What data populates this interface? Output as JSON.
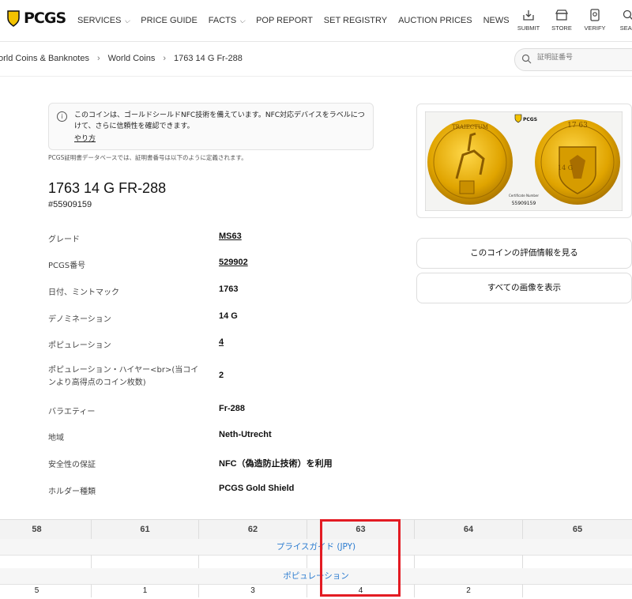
{
  "header": {
    "logo_text": "PCGS",
    "nav": [
      {
        "label": "SERVICES",
        "dropdown": true
      },
      {
        "label": "PRICE GUIDE",
        "dropdown": false
      },
      {
        "label": "FACTS",
        "dropdown": true
      },
      {
        "label": "POP REPORT",
        "dropdown": false
      },
      {
        "label": "SET REGISTRY",
        "dropdown": false
      },
      {
        "label": "AUCTION PRICES",
        "dropdown": false
      },
      {
        "label": "NEWS",
        "dropdown": false
      }
    ],
    "tools": [
      {
        "label": "SUBMIT",
        "icon": "submit-icon"
      },
      {
        "label": "STORE",
        "icon": "store-icon"
      },
      {
        "label": "VERIFY",
        "icon": "verify-icon"
      },
      {
        "label": "SEAR",
        "icon": "search-icon"
      }
    ]
  },
  "breadcrumb": [
    "orld Coins & Banknotes",
    "World Coins",
    "1763 14 G Fr-288"
  ],
  "search": {
    "placeholder": "証明証番号"
  },
  "notice": {
    "text": "このコインは、ゴールドシールドNFC技術を備えています。NFC対応デバイスをラベルにつけて、さらに信頼性を確認できます。",
    "link": "やり方"
  },
  "definition_note": "PCGS証明書データベースでは、証明書番号は以下のように定義されます。",
  "coin": {
    "title": "1763 14 G FR-288",
    "cert_number": "#55909159",
    "specs": [
      {
        "label": "グレード",
        "value": "MS63",
        "link": true
      },
      {
        "label": "PCGS番号",
        "value": "529902",
        "link": true
      },
      {
        "label": "日付、ミントマック",
        "value": "1763",
        "link": false
      },
      {
        "label": "デノミネーション",
        "value": "14 G",
        "link": false
      },
      {
        "label": "ポピュレーション",
        "value": "4",
        "link": true
      },
      {
        "label": "ポピュレーション・ハイヤー<br>(当コインより高得点のコイン枚数)",
        "value": "2",
        "link": false
      },
      {
        "label": "バラエティー",
        "value": "Fr-288",
        "link": false
      },
      {
        "label": "地域",
        "value": "Neth-Utrecht",
        "link": false
      },
      {
        "label": "安全性の保証",
        "value": "NFC（偽造防止技術）を利用",
        "link": false
      },
      {
        "label": "ホルダー種類",
        "value": "PCGS Gold Shield",
        "link": false
      }
    ]
  },
  "image_panel": {
    "label_brand": "PCGS",
    "label_cert_title": "Certificate Number",
    "label_cert_number": "55909159",
    "coin_obverse_legend": "TRAIECTUM",
    "coin_reverse_date": "17 63",
    "coin_reverse_denomination": "14 G"
  },
  "buttons": {
    "price_info": "このコインの評価情報を見る",
    "all_images": "すべての画像を表示"
  },
  "grade_table": {
    "grades": [
      "58",
      "61",
      "62",
      "63",
      "64",
      "65"
    ],
    "price_band": "プライスガイド (JPY)",
    "population_band": "ポピュレーション",
    "population": [
      "5",
      "1",
      "3",
      "4",
      "2",
      ""
    ],
    "highlighted_grade": "63",
    "highlight_color": "#e31b23"
  },
  "colors": {
    "accent_link": "#2a7bd0",
    "logo_yellow": "#f2c200"
  }
}
